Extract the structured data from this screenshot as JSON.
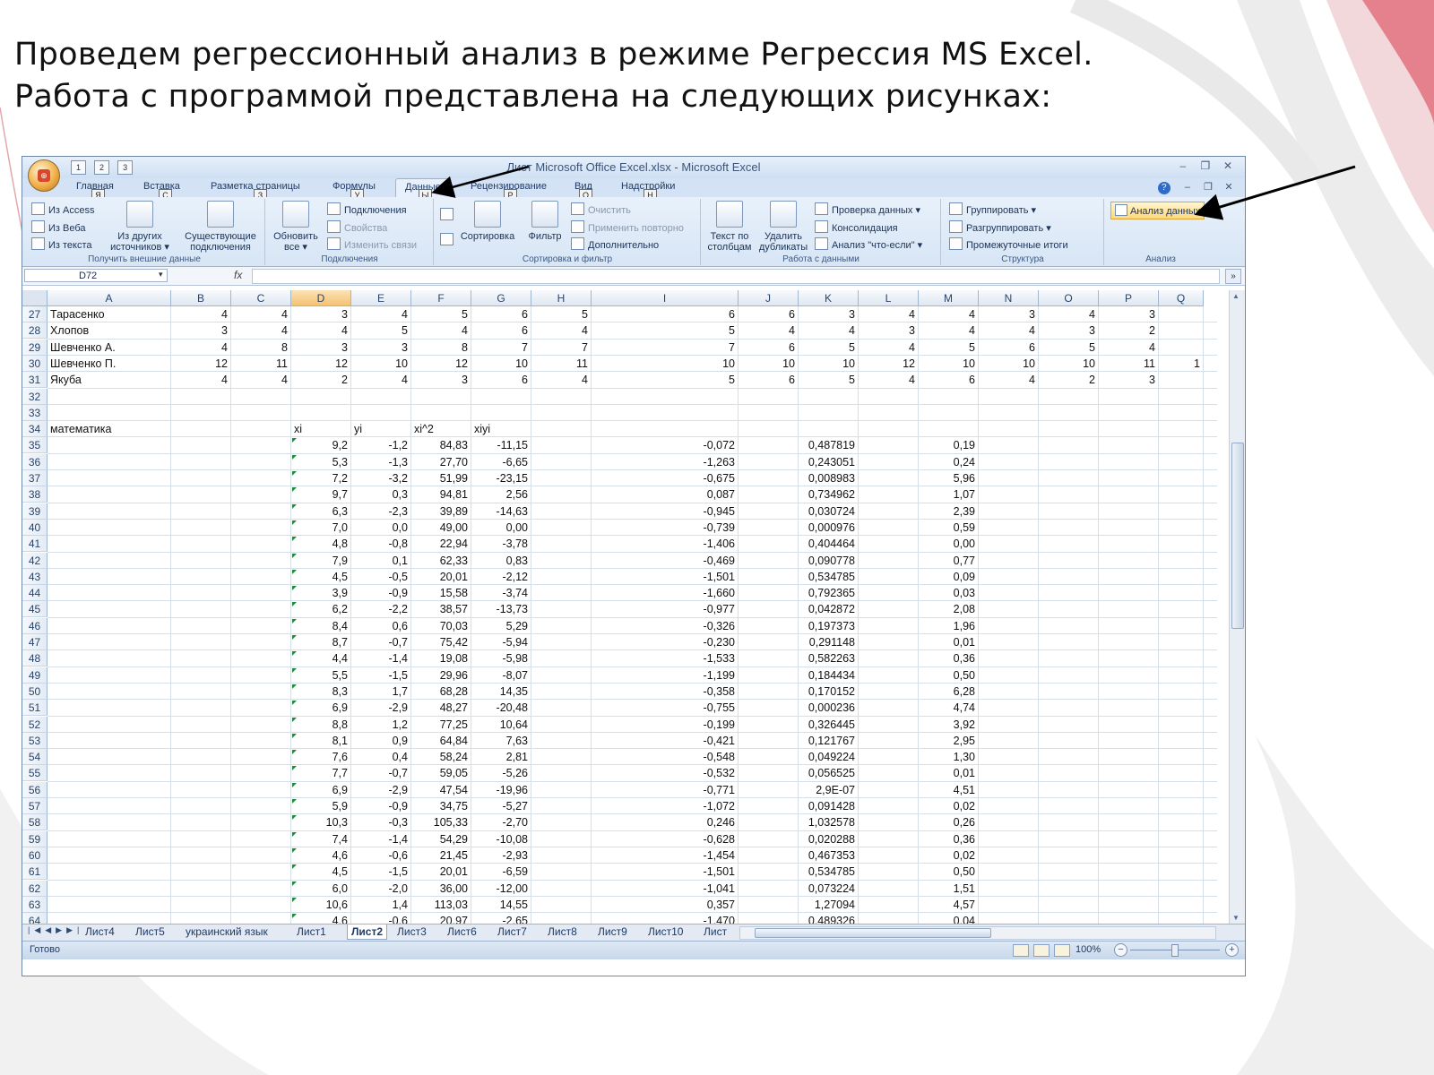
{
  "slide": {
    "heading_line1": "Проведем регрессионный анализ в режиме Регрессия MS Excel.",
    "heading_line2": "Работа с программой представлена на следующих рисунках:"
  },
  "window": {
    "title": "Лист Microsoft Office Excel.xlsx - Microsoft Excel",
    "controls": [
      "–",
      "❐",
      "✕"
    ],
    "qat_keytips": [
      "1",
      "2",
      "3"
    ]
  },
  "tabs": [
    {
      "label": "Главная",
      "key": "Я"
    },
    {
      "label": "Вставка",
      "key": "С"
    },
    {
      "label": "Разметка страницы",
      "key": "З"
    },
    {
      "label": "Формулы",
      "key": "У"
    },
    {
      "label": "Данные",
      "key": "Ы"
    },
    {
      "label": "Рецензирование",
      "key": "Р"
    },
    {
      "label": "Вид",
      "key": "О"
    },
    {
      "label": "Надстройки",
      "key": "Н"
    }
  ],
  "ribbon": {
    "external": {
      "from_access": "Из Access",
      "from_web": "Из Веба",
      "from_text": "Из текста",
      "from_other_1": "Из других",
      "from_other_2": "источников ▾",
      "existing_1": "Существующие",
      "existing_2": "подключения",
      "label": "Получить внешние данные"
    },
    "connections": {
      "refresh_1": "Обновить",
      "refresh_2": "все ▾",
      "conn": "Подключения",
      "props": "Свойства",
      "edit_links": "Изменить связи",
      "label": "Подключения"
    },
    "sort_filter": {
      "sort": "Сортировка",
      "filter": "Фильтр",
      "clear": "Очистить",
      "reapply": "Применить повторно",
      "advanced": "Дополнительно",
      "label": "Сортировка и фильтр"
    },
    "data_tools": {
      "text_cols_1": "Текст по",
      "text_cols_2": "столбцам",
      "remove_dup_1": "Удалить",
      "remove_dup_2": "дубликаты",
      "validation": "Проверка данных ▾",
      "consolidate": "Консолидация",
      "whatif": "Анализ \"что-если\" ▾",
      "label": "Работа с данными"
    },
    "outline": {
      "group": "Группировать ▾",
      "ungroup": "Разгруппировать ▾",
      "subtotal": "Промежуточные итоги",
      "label": "Структура"
    },
    "analysis": {
      "data_analysis": "Анализ данных",
      "label": "Анализ"
    }
  },
  "formula_bar": {
    "name_box": "D72",
    "fx": "fx",
    "dropdown": "▾"
  },
  "columns": [
    "A",
    "B",
    "C",
    "D",
    "E",
    "F",
    "G",
    "H",
    "I",
    "J",
    "K",
    "L",
    "M",
    "N",
    "O",
    "P",
    "Q"
  ],
  "rows_students": [
    {
      "n": "27",
      "name": "Тарасенко",
      "vals": [
        "4",
        "4",
        "3",
        "4",
        "5",
        "6",
        "5",
        "6",
        "6",
        "3",
        "4",
        "4",
        "3",
        "4",
        "3",
        ""
      ]
    },
    {
      "n": "28",
      "name": "Хлопов",
      "vals": [
        "3",
        "4",
        "4",
        "5",
        "4",
        "6",
        "4",
        "5",
        "4",
        "4",
        "3",
        "4",
        "4",
        "3",
        "2",
        ""
      ]
    },
    {
      "n": "29",
      "name": "Шевченко А.",
      "vals": [
        "4",
        "8",
        "3",
        "3",
        "8",
        "7",
        "7",
        "7",
        "6",
        "5",
        "4",
        "5",
        "6",
        "5",
        "4",
        ""
      ]
    },
    {
      "n": "30",
      "name": "Шевченко П.",
      "vals": [
        "12",
        "11",
        "12",
        "10",
        "12",
        "10",
        "11",
        "10",
        "10",
        "10",
        "12",
        "10",
        "10",
        "10",
        "11",
        "1"
      ]
    },
    {
      "n": "31",
      "name": "Якуба",
      "vals": [
        "4",
        "4",
        "2",
        "4",
        "3",
        "6",
        "4",
        "5",
        "6",
        "5",
        "4",
        "6",
        "4",
        "2",
        "3",
        ""
      ]
    }
  ],
  "empty_rows": [
    "32",
    "33"
  ],
  "header_row": {
    "n": "34",
    "a": "математика",
    "d": "xi",
    "e": "yi",
    "f": "xi^2",
    "g": "xiyi"
  },
  "calc_rows": [
    {
      "n": "35",
      "d": "9,2",
      "e": "-1,2",
      "f": "84,83",
      "g": "-11,15",
      "i": "-0,072",
      "k": "0,487819",
      "m": "0,19"
    },
    {
      "n": "36",
      "d": "5,3",
      "e": "-1,3",
      "f": "27,70",
      "g": "-6,65",
      "i": "-1,263",
      "k": "0,243051",
      "m": "0,24"
    },
    {
      "n": "37",
      "d": "7,2",
      "e": "-3,2",
      "f": "51,99",
      "g": "-23,15",
      "i": "-0,675",
      "k": "0,008983",
      "m": "5,96"
    },
    {
      "n": "38",
      "d": "9,7",
      "e": "0,3",
      "f": "94,81",
      "g": "2,56",
      "i": "0,087",
      "k": "0,734962",
      "m": "1,07"
    },
    {
      "n": "39",
      "d": "6,3",
      "e": "-2,3",
      "f": "39,89",
      "g": "-14,63",
      "i": "-0,945",
      "k": "0,030724",
      "m": "2,39"
    },
    {
      "n": "40",
      "d": "7,0",
      "e": "0,0",
      "f": "49,00",
      "g": "0,00",
      "i": "-0,739",
      "k": "0,000976",
      "m": "0,59"
    },
    {
      "n": "41",
      "d": "4,8",
      "e": "-0,8",
      "f": "22,94",
      "g": "-3,78",
      "i": "-1,406",
      "k": "0,404464",
      "m": "0,00"
    },
    {
      "n": "42",
      "d": "7,9",
      "e": "0,1",
      "f": "62,33",
      "g": "0,83",
      "i": "-0,469",
      "k": "0,090778",
      "m": "0,77"
    },
    {
      "n": "43",
      "d": "4,5",
      "e": "-0,5",
      "f": "20,01",
      "g": "-2,12",
      "i": "-1,501",
      "k": "0,534785",
      "m": "0,09"
    },
    {
      "n": "44",
      "d": "3,9",
      "e": "-0,9",
      "f": "15,58",
      "g": "-3,74",
      "i": "-1,660",
      "k": "0,792365",
      "m": "0,03"
    },
    {
      "n": "45",
      "d": "6,2",
      "e": "-2,2",
      "f": "38,57",
      "g": "-13,73",
      "i": "-0,977",
      "k": "0,042872",
      "m": "2,08"
    },
    {
      "n": "46",
      "d": "8,4",
      "e": "0,6",
      "f": "70,03",
      "g": "5,29",
      "i": "-0,326",
      "k": "0,197373",
      "m": "1,96"
    },
    {
      "n": "47",
      "d": "8,7",
      "e": "-0,7",
      "f": "75,42",
      "g": "-5,94",
      "i": "-0,230",
      "k": "0,291148",
      "m": "0,01"
    },
    {
      "n": "48",
      "d": "4,4",
      "e": "-1,4",
      "f": "19,08",
      "g": "-5,98",
      "i": "-1,533",
      "k": "0,582263",
      "m": "0,36"
    },
    {
      "n": "49",
      "d": "5,5",
      "e": "-1,5",
      "f": "29,96",
      "g": "-8,07",
      "i": "-1,199",
      "k": "0,184434",
      "m": "0,50"
    },
    {
      "n": "50",
      "d": "8,3",
      "e": "1,7",
      "f": "68,28",
      "g": "14,35",
      "i": "-0,358",
      "k": "0,170152",
      "m": "6,28"
    },
    {
      "n": "51",
      "d": "6,9",
      "e": "-2,9",
      "f": "48,27",
      "g": "-20,48",
      "i": "-0,755",
      "k": "0,000236",
      "m": "4,74"
    },
    {
      "n": "52",
      "d": "8,8",
      "e": "1,2",
      "f": "77,25",
      "g": "10,64",
      "i": "-0,199",
      "k": "0,326445",
      "m": "3,92"
    },
    {
      "n": "53",
      "d": "8,1",
      "e": "0,9",
      "f": "64,84",
      "g": "7,63",
      "i": "-0,421",
      "k": "0,121767",
      "m": "2,95"
    },
    {
      "n": "54",
      "d": "7,6",
      "e": "0,4",
      "f": "58,24",
      "g": "2,81",
      "i": "-0,548",
      "k": "0,049224",
      "m": "1,30"
    },
    {
      "n": "55",
      "d": "7,7",
      "e": "-0,7",
      "f": "59,05",
      "g": "-5,26",
      "i": "-0,532",
      "k": "0,056525",
      "m": "0,01"
    },
    {
      "n": "56",
      "d": "6,9",
      "e": "-2,9",
      "f": "47,54",
      "g": "-19,96",
      "i": "-0,771",
      "k": "2,9E-07",
      "m": "4,51"
    },
    {
      "n": "57",
      "d": "5,9",
      "e": "-0,9",
      "f": "34,75",
      "g": "-5,27",
      "i": "-1,072",
      "k": "0,091428",
      "m": "0,02"
    },
    {
      "n": "58",
      "d": "10,3",
      "e": "-0,3",
      "f": "105,33",
      "g": "-2,70",
      "i": "0,246",
      "k": "1,032578",
      "m": "0,26"
    },
    {
      "n": "59",
      "d": "7,4",
      "e": "-1,4",
      "f": "54,29",
      "g": "-10,08",
      "i": "-0,628",
      "k": "0,020288",
      "m": "0,36"
    },
    {
      "n": "60",
      "d": "4,6",
      "e": "-0,6",
      "f": "21,45",
      "g": "-2,93",
      "i": "-1,454",
      "k": "0,467353",
      "m": "0,02"
    },
    {
      "n": "61",
      "d": "4,5",
      "e": "-1,5",
      "f": "20,01",
      "g": "-6,59",
      "i": "-1,501",
      "k": "0,534785",
      "m": "0,50"
    },
    {
      "n": "62",
      "d": "6,0",
      "e": "-2,0",
      "f": "36,00",
      "g": "-12,00",
      "i": "-1,041",
      "k": "0,073224",
      "m": "1,51"
    },
    {
      "n": "63",
      "d": "10,6",
      "e": "1,4",
      "f": "113,03",
      "g": "14,55",
      "i": "0,357",
      "k": "1,27094",
      "m": "4,57"
    },
    {
      "n": "64",
      "d": "4,6",
      "e": "-0,6",
      "f": "20,97",
      "g": "-2,65",
      "i": "-1,470",
      "k": "0,489326",
      "m": "0,04"
    }
  ],
  "sheet_tabs": [
    "Лист4",
    "Лист5",
    "украинский язык",
    "Лист1",
    "Лист2",
    "Лист3",
    "Лист6",
    "Лист7",
    "Лист8",
    "Лист9",
    "Лист10",
    "Лист"
  ],
  "active_sheet": "Лист2",
  "status": {
    "ready": "Готово",
    "zoom": "100%",
    "minus": "−",
    "plus": "+"
  },
  "colors": {
    "accent": "#c8102e",
    "ribbon": "#d7e5f5",
    "selected_header": "#f5c272"
  }
}
